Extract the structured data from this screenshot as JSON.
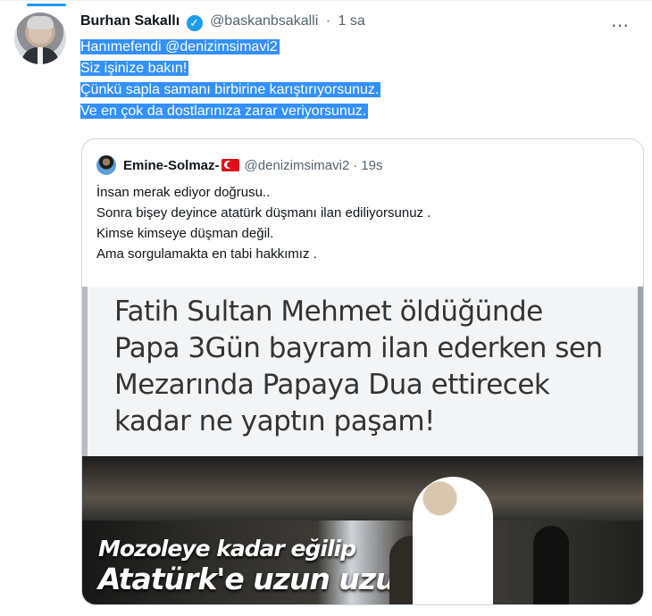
{
  "tweet": {
    "author_name": "Burhan Sakallı",
    "verified_icon": "verified-badge-icon",
    "handle": "@baskanbsakalli",
    "separator": "·",
    "time": "1 sa",
    "more_icon": "more-icon",
    "text_lines": [
      "Hanımefendi @denizimsimavi2",
      "Siz işinize bakın!",
      "Çünkü sapla samanı birbirine karıştırıyorsunuz.",
      "Ve en çok da dostlarınıza zarar veriyorsunuz."
    ],
    "selection_color": "#3390ff"
  },
  "quote": {
    "author_name": "Emine-Solmaz-",
    "flag_icon": "turkey-flag-icon",
    "handle": "@denizimsimavi2",
    "separator": "·",
    "time": "19s",
    "text_lines": [
      "İnsan merak ediyor doğrusu..",
      "Sonra bişey deyince atatürk düşmanı ilan ediliyorsunuz .",
      "Kimse kimseye düşman değil.",
      "Ama sorgulamakta en tabi hakkımız ."
    ],
    "image": {
      "caption_lines": [
        "Fatih Sultan Mehmet öldüğünde",
        "Papa 3Gün bayram ilan ederken sen",
        "Mezarında Papaya Dua ettirecek",
        "kadar ne yaptın paşam!"
      ],
      "photo_caption_lines": [
        "Mozoleye kadar eğilip",
        "Atatürk'e uzun uzun"
      ]
    }
  },
  "colors": {
    "accent": "#1d9bf0",
    "text": "#0f1419",
    "muted": "#536471",
    "border": "#cfd9de"
  }
}
